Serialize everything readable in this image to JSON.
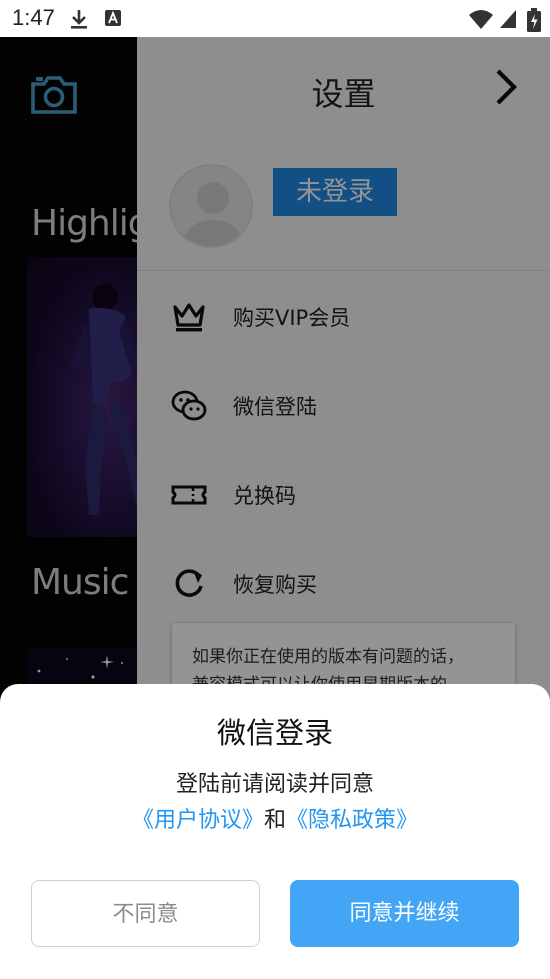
{
  "status_bar": {
    "time": "1:47",
    "icons": [
      "download-icon",
      "a-notification-icon",
      "wifi-icon",
      "signal-icon",
      "battery-charging-icon"
    ]
  },
  "background_app": {
    "icons": [
      "camera-icon"
    ],
    "sections": [
      {
        "title": "Highlig"
      },
      {
        "title": "Music V"
      }
    ]
  },
  "drawer": {
    "title": "设置",
    "login_status": "未登录",
    "menu_items": [
      {
        "icon": "crown-icon",
        "label": "购买VIP会员"
      },
      {
        "icon": "wechat-icon",
        "label": "微信登陆"
      },
      {
        "icon": "ticket-icon",
        "label": "兑换码"
      },
      {
        "icon": "refresh-icon",
        "label": "恢复购买"
      }
    ],
    "notice": {
      "line1": "如果你正在使用的版本有问题的话，",
      "line2": "兼容模式可以让你使用早期版本的"
    }
  },
  "dialog": {
    "title": "微信登录",
    "message": "登陆前请阅读并同意",
    "user_agreement": "《用户协议》",
    "conjunction": "和",
    "privacy_policy": "《隐私政策》",
    "disagree_label": "不同意",
    "agree_label": "同意并继续"
  },
  "colors": {
    "accent": "#42a5f5",
    "badge": "#1e88e5",
    "link": "#2196f3",
    "camera": "#4aa3c8"
  }
}
